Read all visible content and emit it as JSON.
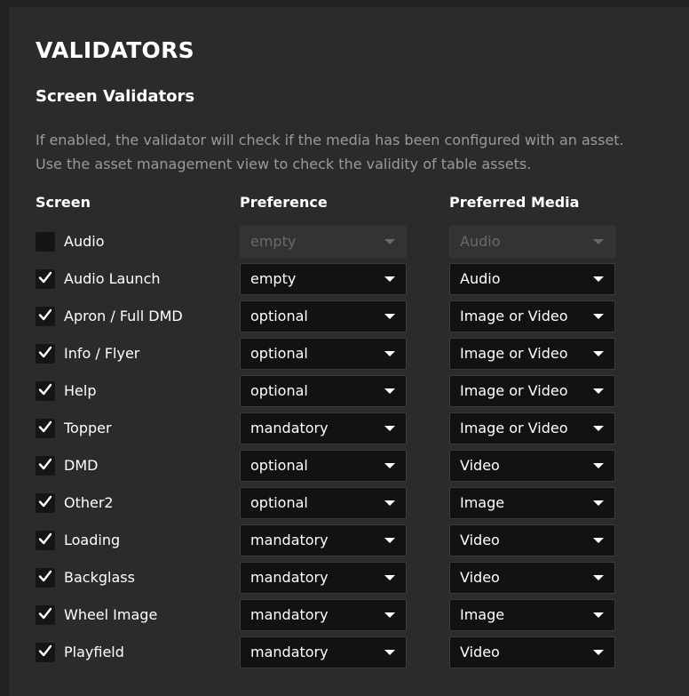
{
  "header": {
    "title": "VALIDATORS",
    "subtitle": "Screen Validators",
    "description_line1": "If enabled, the validator will check if the media has been configured with an asset.",
    "description_line2": "Use the asset management view to check the validity of table assets."
  },
  "columns": {
    "screen": "Screen",
    "preference": "Preference",
    "media": "Preferred Media"
  },
  "rows": [
    {
      "checked": false,
      "label": "Audio",
      "preference": "empty",
      "media": "Audio",
      "disabled": true
    },
    {
      "checked": true,
      "label": "Audio Launch",
      "preference": "empty",
      "media": "Audio",
      "disabled": false
    },
    {
      "checked": true,
      "label": "Apron / Full DMD",
      "preference": "optional",
      "media": "Image or Video",
      "disabled": false
    },
    {
      "checked": true,
      "label": "Info / Flyer",
      "preference": "optional",
      "media": "Image or Video",
      "disabled": false
    },
    {
      "checked": true,
      "label": "Help",
      "preference": "optional",
      "media": "Image or Video",
      "disabled": false
    },
    {
      "checked": true,
      "label": "Topper",
      "preference": "mandatory",
      "media": "Image or Video",
      "disabled": false
    },
    {
      "checked": true,
      "label": "DMD",
      "preference": "optional",
      "media": "Video",
      "disabled": false
    },
    {
      "checked": true,
      "label": "Other2",
      "preference": "optional",
      "media": "Image",
      "disabled": false
    },
    {
      "checked": true,
      "label": "Loading",
      "preference": "mandatory",
      "media": "Video",
      "disabled": false
    },
    {
      "checked": true,
      "label": "Backglass",
      "preference": "mandatory",
      "media": "Video",
      "disabled": false
    },
    {
      "checked": true,
      "label": "Wheel Image",
      "preference": "mandatory",
      "media": "Image",
      "disabled": false
    },
    {
      "checked": true,
      "label": "Playfield",
      "preference": "mandatory",
      "media": "Video",
      "disabled": false
    }
  ]
}
